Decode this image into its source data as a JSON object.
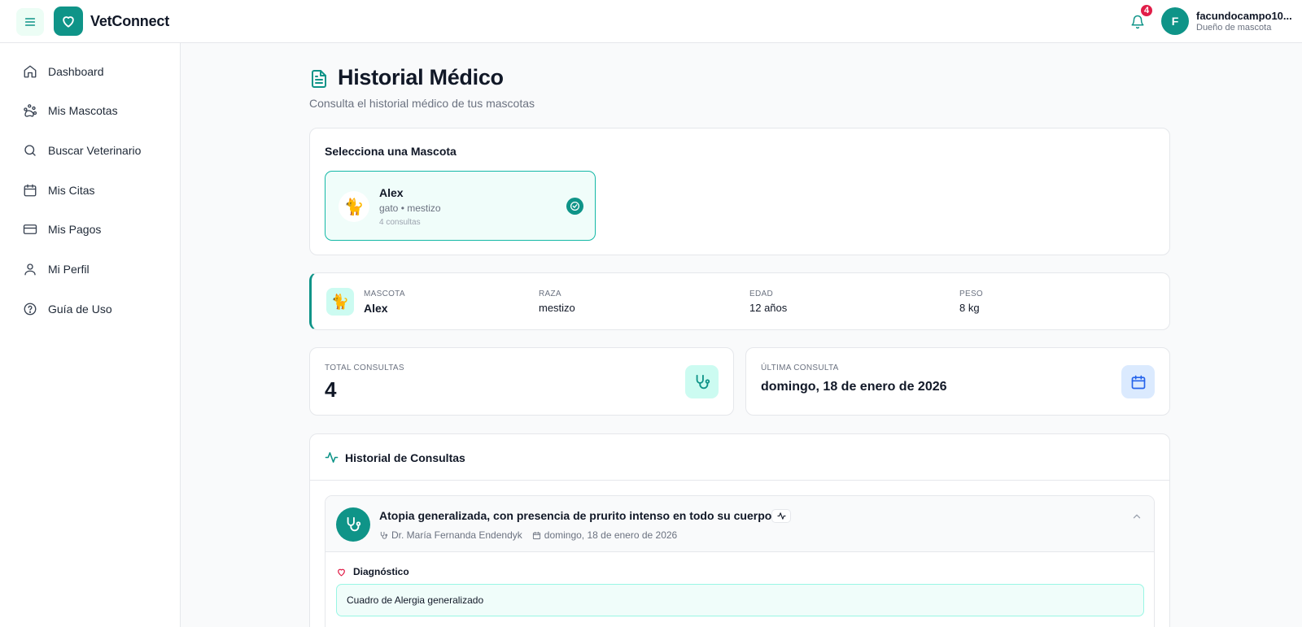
{
  "app": {
    "name": "VetConnect",
    "colors": {
      "primary": "#0f9488",
      "accent_bg": "#ecfdf5",
      "badge": "#e11d48",
      "date_accent": "#2563eb"
    }
  },
  "header": {
    "notifications_count": "4",
    "user": {
      "initial": "F",
      "name": "facundocampo10...",
      "role": "Dueño de mascota"
    }
  },
  "sidebar": {
    "items": [
      {
        "label": "Dashboard",
        "icon": "home-icon"
      },
      {
        "label": "Mis Mascotas",
        "icon": "paw-icon"
      },
      {
        "label": "Buscar Veterinario",
        "icon": "search-icon"
      },
      {
        "label": "Mis Citas",
        "icon": "calendar-icon"
      },
      {
        "label": "Mis Pagos",
        "icon": "credit-card-icon"
      },
      {
        "label": "Mi Perfil",
        "icon": "user-icon"
      },
      {
        "label": "Guía de Uso",
        "icon": "help-circle-icon"
      }
    ]
  },
  "page": {
    "title": "Historial Médico",
    "subtitle": "Consulta el historial médico de tus mascotas"
  },
  "pet_selector": {
    "title": "Selecciona una Mascota",
    "pets": [
      {
        "emoji": "🐈",
        "name": "Alex",
        "type": "gato • mestizo",
        "consults": "4 consultas",
        "selected": true
      }
    ]
  },
  "pet_info": {
    "emoji": "🐈",
    "mascota_label": "MASCOTA",
    "mascota": "Alex",
    "raza_label": "RAZA",
    "raza": "mestizo",
    "edad_label": "EDAD",
    "edad": "12 años",
    "peso_label": "PESO",
    "peso": "8 kg"
  },
  "stats": {
    "total_label": "TOTAL CONSULTAS",
    "total": "4",
    "ultima_label": "ÚLTIMA CONSULTA",
    "ultima": "domingo, 18 de enero de 2026"
  },
  "history": {
    "title": "Historial de Consultas",
    "consults": [
      {
        "title": "Atopia generalizada, con presencia de prurito intenso en todo su cuerpo.",
        "doctor": "Dr. María Fernanda Endendyk",
        "date": "domingo, 18 de enero de 2026",
        "diagnosis_label": "Diagnóstico",
        "diagnosis": "Cuadro de Alergia generalizado"
      }
    ]
  }
}
